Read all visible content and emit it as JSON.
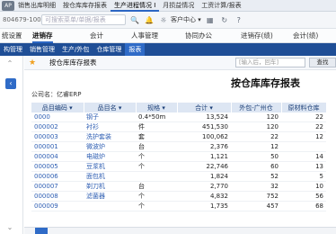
{
  "topbar": {
    "logo": "AP",
    "tabs": [
      {
        "label": "销售出库明细"
      },
      {
        "label": "按仓库库存报表"
      },
      {
        "label": "生产进程情况 I"
      },
      {
        "label": "月损益情况"
      },
      {
        "label": "工资计算/报表"
      }
    ]
  },
  "searchbar": {
    "account": "804679-100",
    "search_placeholder": "可搜索菜单/单据/报表",
    "service_label": "客户中心 ▾"
  },
  "mainnav": {
    "items": [
      {
        "label": "统设置"
      },
      {
        "label": "进销存"
      },
      {
        "label": "会计"
      },
      {
        "label": "人事管理"
      },
      {
        "label": "协同办公"
      },
      {
        "label": "进销存(绩)"
      },
      {
        "label": "会计(绩)"
      }
    ]
  },
  "subnav": {
    "items": [
      {
        "label": "构管理"
      },
      {
        "label": "销售管理"
      },
      {
        "label": "生产/外包"
      },
      {
        "label": "仓库管理"
      },
      {
        "label": "报表"
      }
    ]
  },
  "toolbar": {
    "report_tab": "按仓库库存报表",
    "find_placeholder": "[输入后，回车]",
    "find_button": "查找"
  },
  "report": {
    "title": "按仓库库存报表",
    "company": "公司名：亿睿ERP",
    "columns": [
      "品目编码 ▾",
      "品目名 ▾",
      "规格 ▾",
      "合计 ▾",
      "外包-广州仓",
      "原材料仓库"
    ],
    "rows": [
      [
        "0000",
        "钢子",
        "0.4*50m",
        "13,524",
        "120",
        "22"
      ],
      [
        "000002",
        "衬衫",
        "件",
        "451,530",
        "120",
        "22"
      ],
      [
        "000003",
        "洗护套装",
        "套",
        "100,062",
        "22",
        "12"
      ],
      [
        "000001",
        "微波炉",
        "台",
        "2,376",
        "12",
        ""
      ],
      [
        "000004",
        "电磁炉",
        "个",
        "1,121",
        "50",
        "14"
      ],
      [
        "000005",
        "豆浆机",
        "个",
        "22,746",
        "60",
        "13"
      ],
      [
        "000006",
        "面包机",
        "",
        "1,824",
        "52",
        "5"
      ],
      [
        "000007",
        "剃刀机",
        "台",
        "2,770",
        "32",
        "10"
      ],
      [
        "000008",
        "滤菌器",
        "个",
        "4,832",
        "752",
        "56"
      ],
      [
        "000009",
        "",
        "个",
        "1,735",
        "457",
        "68"
      ]
    ]
  }
}
